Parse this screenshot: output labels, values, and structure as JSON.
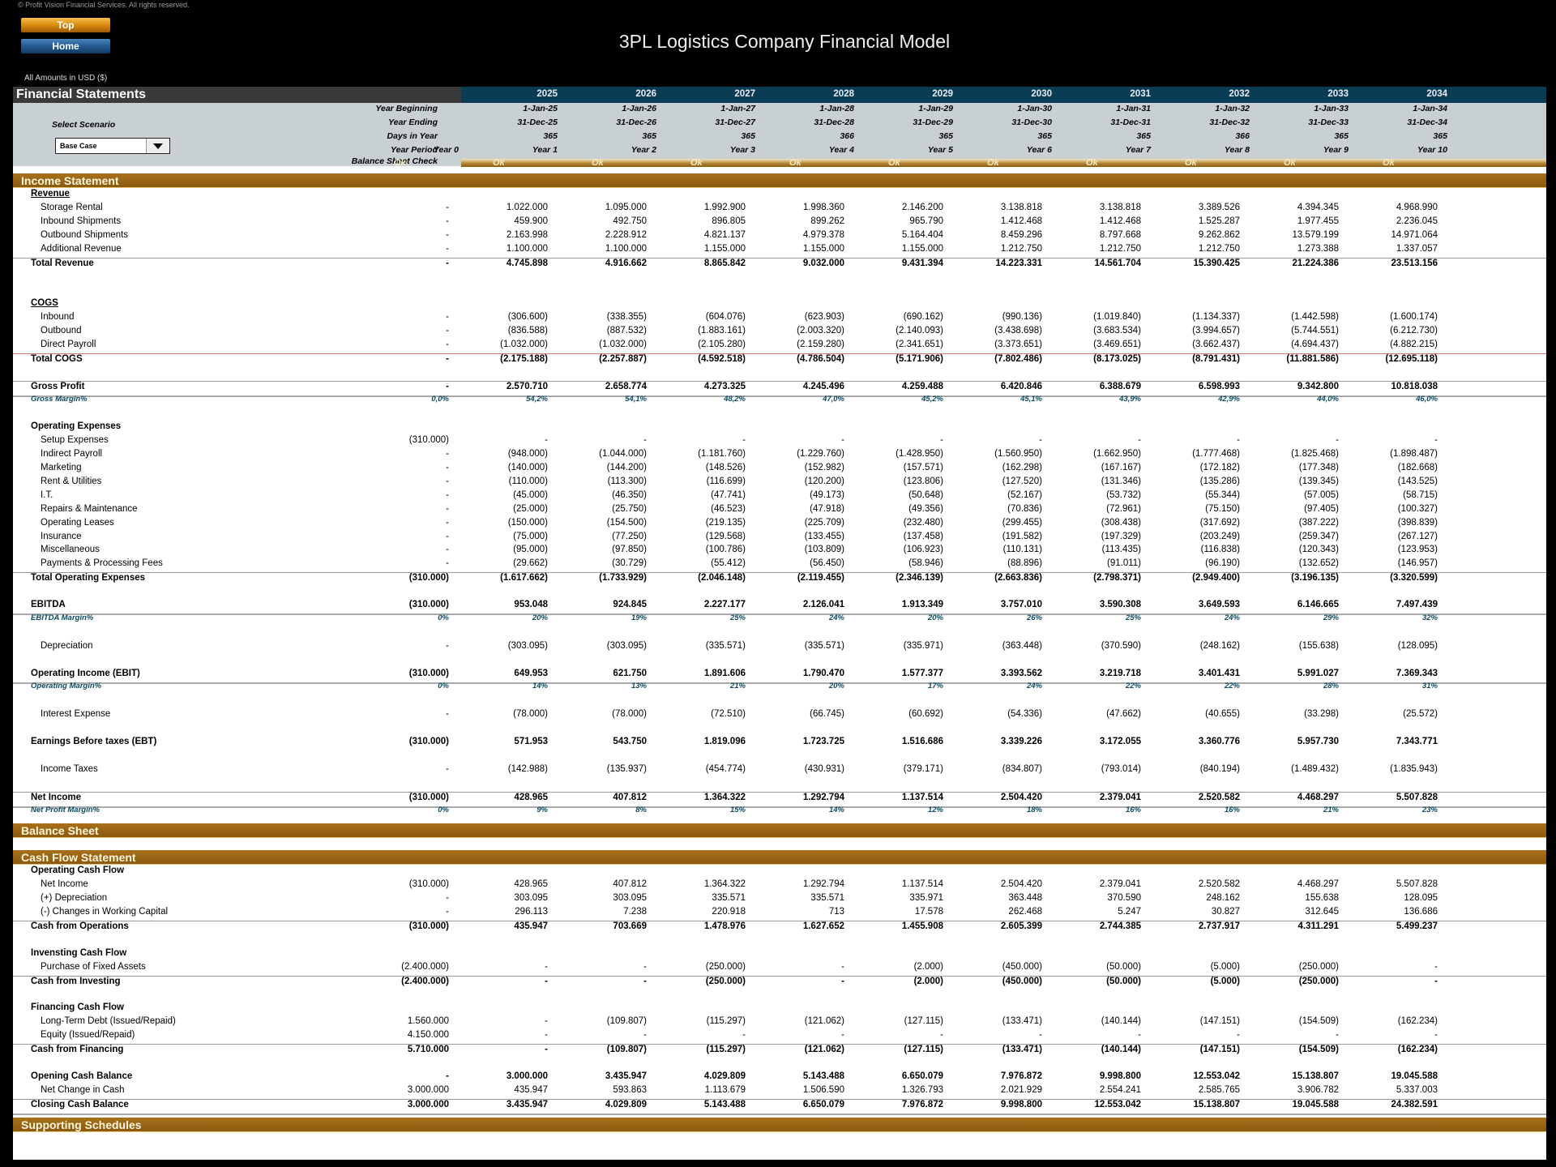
{
  "copyright": "© Profit Vision Financial Services. All rights reserved.",
  "nav": {
    "top": "Top",
    "home": "Home"
  },
  "title": "3PL Logistics Company Financial Model",
  "amounts_note": "All Amounts in  USD ($)",
  "fs_title": "Financial Statements",
  "scenario": {
    "label": "Select Scenario",
    "value": "Base Case"
  },
  "header_labels": {
    "year_beginning": "Year Beginning",
    "year_ending": "Year Ending",
    "days": "Days in Year",
    "period": "Year Period",
    "bs_check": "Balance Sheet Check"
  },
  "years": [
    "2025",
    "2026",
    "2027",
    "2028",
    "2029",
    "2030",
    "2031",
    "2032",
    "2033",
    "2034"
  ],
  "year_beginning": [
    "1-Jan-25",
    "1-Jan-26",
    "1-Jan-27",
    "1-Jan-28",
    "1-Jan-29",
    "1-Jan-30",
    "1-Jan-31",
    "1-Jan-32",
    "1-Jan-33",
    "1-Jan-34"
  ],
  "year_ending": [
    "31-Dec-25",
    "31-Dec-26",
    "31-Dec-27",
    "31-Dec-28",
    "31-Dec-29",
    "31-Dec-30",
    "31-Dec-31",
    "31-Dec-32",
    "31-Dec-33",
    "31-Dec-34"
  ],
  "days": [
    "365",
    "365",
    "365",
    "366",
    "365",
    "365",
    "365",
    "366",
    "365",
    "365"
  ],
  "periods": [
    "Year 0",
    "Year 1",
    "Year 2",
    "Year 3",
    "Year 4",
    "Year 5",
    "Year 6",
    "Year 7",
    "Year 8",
    "Year 9",
    "Year 10"
  ],
  "bs_check": [
    "Ok",
    "Ok",
    "Ok",
    "Ok",
    "Ok",
    "Ok",
    "Ok",
    "Ok",
    "Ok",
    "Ok",
    "Ok"
  ],
  "sections": {
    "income": "Income Statement",
    "balance": "Balance Sheet",
    "cashflow": "Cash Flow Statement",
    "supporting": "Supporting Schedules"
  },
  "income_rows": [
    {
      "label": "Revenue",
      "type": "hdr und",
      "values": []
    },
    {
      "label": "Storage Rental",
      "type": "ind",
      "values": [
        "-",
        "1.022.000",
        "1.095.000",
        "1.992.900",
        "1.998.360",
        "2.146.200",
        "3.138.818",
        "3.138.818",
        "3.389.526",
        "4.394.345",
        "4.968.990"
      ]
    },
    {
      "label": "Inbound Shipments",
      "type": "ind",
      "values": [
        "-",
        "459.900",
        "492.750",
        "896.805",
        "899.262",
        "965.790",
        "1.412.468",
        "1.412.468",
        "1.525.287",
        "1.977.455",
        "2.236.045"
      ]
    },
    {
      "label": "Outbound Shipments",
      "type": "ind",
      "values": [
        "-",
        "2.163.998",
        "2.228.912",
        "4.821.137",
        "4.979.378",
        "5.164.404",
        "8.459.296",
        "8.797.668",
        "9.262.862",
        "13.579.199",
        "14.971.064"
      ]
    },
    {
      "label": "Additional Revenue",
      "type": "ind",
      "values": [
        "-",
        "1.100.000",
        "1.100.000",
        "1.155.000",
        "1.155.000",
        "1.155.000",
        "1.212.750",
        "1.212.750",
        "1.212.750",
        "1.273.388",
        "1.337.057"
      ]
    },
    {
      "label": "Total Revenue",
      "type": "bold topline",
      "values": [
        "-",
        "4.745.898",
        "4.916.662",
        "8.865.842",
        "9.032.000",
        "9.431.394",
        "14.223.331",
        "14.561.704",
        "15.390.425",
        "21.224.386",
        "23.513.156"
      ]
    },
    {
      "label": "",
      "type": "blank",
      "values": []
    },
    {
      "label": "",
      "type": "blank",
      "values": []
    },
    {
      "label": "COGS",
      "type": "hdr und",
      "values": []
    },
    {
      "label": "Inbound",
      "type": "ind",
      "values": [
        "-",
        "(306.600)",
        "(338.355)",
        "(604.076)",
        "(623.903)",
        "(690.162)",
        "(990.136)",
        "(1.019.840)",
        "(1.134.337)",
        "(1.442.598)",
        "(1.600.174)"
      ]
    },
    {
      "label": "Outbound",
      "type": "ind",
      "values": [
        "-",
        "(836.588)",
        "(887.532)",
        "(1.883.161)",
        "(2.003.320)",
        "(2.140.093)",
        "(3.438.698)",
        "(3.683.534)",
        "(3.994.657)",
        "(5.744.551)",
        "(6.212.730)"
      ]
    },
    {
      "label": "Direct Payroll",
      "type": "ind",
      "values": [
        "-",
        "(1.032.000)",
        "(1.032.000)",
        "(2.105.280)",
        "(2.159.280)",
        "(2.341.651)",
        "(3.373.651)",
        "(3.469.651)",
        "(3.662.437)",
        "(4.694.437)",
        "(4.882.215)"
      ]
    },
    {
      "label": "Total COGS",
      "type": "bold redline",
      "values": [
        "-",
        "(2.175.188)",
        "(2.257.887)",
        "(4.592.518)",
        "(4.786.504)",
        "(5.171.906)",
        "(7.802.486)",
        "(8.173.025)",
        "(8.791.431)",
        "(11.881.586)",
        "(12.695.118)"
      ]
    },
    {
      "label": "",
      "type": "blank",
      "values": []
    },
    {
      "label": "Gross Profit",
      "type": "bold topline dbl",
      "values": [
        "-",
        "2.570.710",
        "2.658.774",
        "4.273.325",
        "4.245.496",
        "4.259.488",
        "6.420.846",
        "6.388.679",
        "6.598.993",
        "9.342.800",
        "10.818.038"
      ]
    },
    {
      "label": "Gross Margin%",
      "type": "pct",
      "values": [
        "0,0%",
        "54,2%",
        "54,1%",
        "48,2%",
        "47,0%",
        "45,2%",
        "45,1%",
        "43,9%",
        "42,9%",
        "44,0%",
        "46,0%"
      ]
    },
    {
      "label": "",
      "type": "blank",
      "values": []
    },
    {
      "label": "Operating Expenses",
      "type": "hdr",
      "values": []
    },
    {
      "label": "Setup Expenses",
      "type": "ind",
      "values": [
        "(310.000)",
        "-",
        "-",
        "-",
        "-",
        "-",
        "-",
        "-",
        "-",
        "-",
        "-"
      ]
    },
    {
      "label": "Indirect Payroll",
      "type": "ind",
      "values": [
        "-",
        "(948.000)",
        "(1.044.000)",
        "(1.181.760)",
        "(1.229.760)",
        "(1.428.950)",
        "(1.560.950)",
        "(1.662.950)",
        "(1.777.468)",
        "(1.825.468)",
        "(1.898.487)"
      ]
    },
    {
      "label": "Marketing",
      "type": "ind",
      "values": [
        "-",
        "(140.000)",
        "(144.200)",
        "(148.526)",
        "(152.982)",
        "(157.571)",
        "(162.298)",
        "(167.167)",
        "(172.182)",
        "(177.348)",
        "(182.668)"
      ]
    },
    {
      "label": "Rent & Utilities",
      "type": "ind",
      "values": [
        "-",
        "(110.000)",
        "(113.300)",
        "(116.699)",
        "(120.200)",
        "(123.806)",
        "(127.520)",
        "(131.346)",
        "(135.286)",
        "(139.345)",
        "(143.525)"
      ]
    },
    {
      "label": "I.T.",
      "type": "ind",
      "values": [
        "-",
        "(45.000)",
        "(46.350)",
        "(47.741)",
        "(49.173)",
        "(50.648)",
        "(52.167)",
        "(53.732)",
        "(55.344)",
        "(57.005)",
        "(58.715)"
      ]
    },
    {
      "label": "Repairs & Maintenance",
      "type": "ind",
      "values": [
        "-",
        "(25.000)",
        "(25.750)",
        "(46.523)",
        "(47.918)",
        "(49.356)",
        "(70.836)",
        "(72.961)",
        "(75.150)",
        "(97.405)",
        "(100.327)"
      ]
    },
    {
      "label": "Operating Leases",
      "type": "ind",
      "values": [
        "-",
        "(150.000)",
        "(154.500)",
        "(219.135)",
        "(225.709)",
        "(232.480)",
        "(299.455)",
        "(308.438)",
        "(317.692)",
        "(387.222)",
        "(398.839)"
      ]
    },
    {
      "label": "Insurance",
      "type": "ind",
      "values": [
        "-",
        "(75.000)",
        "(77.250)",
        "(129.568)",
        "(133.455)",
        "(137.458)",
        "(191.582)",
        "(197.329)",
        "(203.249)",
        "(259.347)",
        "(267.127)"
      ]
    },
    {
      "label": "Miscellaneous",
      "type": "ind",
      "values": [
        "-",
        "(95.000)",
        "(97.850)",
        "(100.786)",
        "(103.809)",
        "(106.923)",
        "(110.131)",
        "(113.435)",
        "(116.838)",
        "(120.343)",
        "(123.953)"
      ]
    },
    {
      "label": "Payments & Processing Fees",
      "type": "ind",
      "values": [
        "-",
        "(29.662)",
        "(30.729)",
        "(55.412)",
        "(56.450)",
        "(58.946)",
        "(88.896)",
        "(91.011)",
        "(96.190)",
        "(132.652)",
        "(146.957)"
      ]
    },
    {
      "label": "Total Operating Expenses",
      "type": "bold topline",
      "values": [
        "(310.000)",
        "(1.617.662)",
        "(1.733.929)",
        "(2.046.148)",
        "(2.119.455)",
        "(2.346.139)",
        "(2.663.836)",
        "(2.798.371)",
        "(2.949.400)",
        "(3.196.135)",
        "(3.320.599)"
      ]
    },
    {
      "label": "",
      "type": "blank",
      "values": []
    },
    {
      "label": "EBITDA",
      "type": "bold dbl",
      "values": [
        "(310.000)",
        "953.048",
        "924.845",
        "2.227.177",
        "2.126.041",
        "1.913.349",
        "3.757.010",
        "3.590.308",
        "3.649.593",
        "6.146.665",
        "7.497.439"
      ]
    },
    {
      "label": "EBITDA Margin%",
      "type": "pct",
      "values": [
        "0%",
        "20%",
        "19%",
        "25%",
        "24%",
        "20%",
        "26%",
        "25%",
        "24%",
        "29%",
        "32%"
      ]
    },
    {
      "label": "",
      "type": "blank",
      "values": []
    },
    {
      "label": "Depreciation",
      "type": "ind",
      "values": [
        "-",
        "(303.095)",
        "(303.095)",
        "(335.571)",
        "(335.571)",
        "(335.971)",
        "(363.448)",
        "(370.590)",
        "(248.162)",
        "(155.638)",
        "(128.095)"
      ]
    },
    {
      "label": "",
      "type": "blank",
      "values": []
    },
    {
      "label": "Operating Income (EBIT)",
      "type": "bold dbl",
      "values": [
        "(310.000)",
        "649.953",
        "621.750",
        "1.891.606",
        "1.790.470",
        "1.577.377",
        "3.393.562",
        "3.219.718",
        "3.401.431",
        "5.991.027",
        "7.369.343"
      ]
    },
    {
      "label": "Operating Margin%",
      "type": "pct",
      "values": [
        "0%",
        "14%",
        "13%",
        "21%",
        "20%",
        "17%",
        "24%",
        "22%",
        "22%",
        "28%",
        "31%"
      ]
    },
    {
      "label": "",
      "type": "blank",
      "values": []
    },
    {
      "label": "Interest Expense",
      "type": "ind",
      "values": [
        "-",
        "(78.000)",
        "(78.000)",
        "(72.510)",
        "(66.745)",
        "(60.692)",
        "(54.336)",
        "(47.662)",
        "(40.655)",
        "(33.298)",
        "(25.572)"
      ]
    },
    {
      "label": "",
      "type": "blank",
      "values": []
    },
    {
      "label": "Earnings Before taxes (EBT)",
      "type": "bold",
      "values": [
        "(310.000)",
        "571.953",
        "543.750",
        "1.819.096",
        "1.723.725",
        "1.516.686",
        "3.339.226",
        "3.172.055",
        "3.360.776",
        "5.957.730",
        "7.343.771"
      ]
    },
    {
      "label": "",
      "type": "blank",
      "values": []
    },
    {
      "label": "Income Taxes",
      "type": "ind",
      "values": [
        "-",
        "(142.988)",
        "(135.937)",
        "(454.774)",
        "(430.931)",
        "(379.171)",
        "(834.807)",
        "(793.014)",
        "(840.194)",
        "(1.489.432)",
        "(1.835.943)"
      ]
    },
    {
      "label": "",
      "type": "blank",
      "values": []
    },
    {
      "label": "Net Income",
      "type": "bold topline dbl",
      "values": [
        "(310.000)",
        "428.965",
        "407.812",
        "1.364.322",
        "1.292.794",
        "1.137.514",
        "2.504.420",
        "2.379.041",
        "2.520.582",
        "4.468.297",
        "5.507.828"
      ]
    },
    {
      "label": "Net Profit Margin%",
      "type": "pct",
      "values": [
        "0%",
        "9%",
        "8%",
        "15%",
        "14%",
        "12%",
        "18%",
        "16%",
        "16%",
        "21%",
        "23%"
      ]
    }
  ],
  "cashflow_rows": [
    {
      "label": "Operating Cash Flow",
      "type": "hdr",
      "values": []
    },
    {
      "label": "Net Income",
      "type": "ind",
      "values": [
        "(310.000)",
        "428.965",
        "407.812",
        "1.364.322",
        "1.292.794",
        "1.137.514",
        "2.504.420",
        "2.379.041",
        "2.520.582",
        "4.468.297",
        "5.507.828"
      ]
    },
    {
      "label": "(+) Depreciation",
      "type": "ind",
      "values": [
        "-",
        "303.095",
        "303.095",
        "335.571",
        "335.571",
        "335.971",
        "363.448",
        "370.590",
        "248.162",
        "155.638",
        "128.095"
      ]
    },
    {
      "label": "(-) Changes in Working Capital",
      "type": "ind",
      "values": [
        "-",
        "296.113",
        "7.238",
        "220.918",
        "713",
        "17.578",
        "262.468",
        "5.247",
        "30.827",
        "312.645",
        "136.686"
      ]
    },
    {
      "label": "Cash from Operations",
      "type": "bold topline",
      "values": [
        "(310.000)",
        "435.947",
        "703.669",
        "1.478.976",
        "1.627.652",
        "1.455.908",
        "2.605.399",
        "2.744.385",
        "2.737.917",
        "4.311.291",
        "5.499.237"
      ]
    },
    {
      "label": "",
      "type": "blank",
      "values": []
    },
    {
      "label": "Invensting Cash Flow",
      "type": "hdr",
      "values": []
    },
    {
      "label": "Purchase of Fixed Assets",
      "type": "ind",
      "values": [
        "(2.400.000)",
        "-",
        "-",
        "(250.000)",
        "-",
        "(2.000)",
        "(450.000)",
        "(50.000)",
        "(5.000)",
        "(250.000)",
        "-"
      ]
    },
    {
      "label": "Cash from Investing",
      "type": "bold topline",
      "values": [
        "(2.400.000)",
        "-",
        "-",
        "(250.000)",
        "-",
        "(2.000)",
        "(450.000)",
        "(50.000)",
        "(5.000)",
        "(250.000)",
        "-"
      ]
    },
    {
      "label": "",
      "type": "blank",
      "values": []
    },
    {
      "label": "Financing Cash Flow",
      "type": "hdr",
      "values": []
    },
    {
      "label": "Long-Term Debt (Issued/Repaid)",
      "type": "ind",
      "values": [
        "1.560.000",
        "-",
        "(109.807)",
        "(115.297)",
        "(121.062)",
        "(127.115)",
        "(133.471)",
        "(140.144)",
        "(147.151)",
        "(154.509)",
        "(162.234)"
      ]
    },
    {
      "label": "Equity (Issued/Repaid)",
      "type": "ind",
      "values": [
        "4.150.000",
        "-",
        "-",
        "-",
        "-",
        "-",
        "-",
        "-",
        "-",
        "-",
        "-"
      ]
    },
    {
      "label": "Cash from Financing",
      "type": "bold topline",
      "values": [
        "5.710.000",
        "-",
        "(109.807)",
        "(115.297)",
        "(121.062)",
        "(127.115)",
        "(133.471)",
        "(140.144)",
        "(147.151)",
        "(154.509)",
        "(162.234)"
      ]
    },
    {
      "label": "",
      "type": "blank",
      "values": []
    },
    {
      "label": "Opening Cash Balance",
      "type": "bold",
      "values": [
        "-",
        "3.000.000",
        "3.435.947",
        "4.029.809",
        "5.143.488",
        "6.650.079",
        "7.976.872",
        "9.998.800",
        "12.553.042",
        "15.138.807",
        "19.045.588"
      ]
    },
    {
      "label": "Net Change in Cash",
      "type": "ind",
      "values": [
        "3.000.000",
        "435.947",
        "593.863",
        "1.113.679",
        "1.506.590",
        "1.326.793",
        "2.021.929",
        "2.554.241",
        "2.585.765",
        "3.906.782",
        "5.337.003"
      ]
    },
    {
      "label": "Closing Cash Balance",
      "type": "bold topline dbl",
      "values": [
        "3.000.000",
        "3.435.947",
        "4.029.809",
        "5.143.488",
        "6.650.079",
        "7.976.872",
        "9.998.800",
        "12.553.042",
        "15.138.807",
        "19.045.588",
        "24.382.591"
      ]
    }
  ]
}
